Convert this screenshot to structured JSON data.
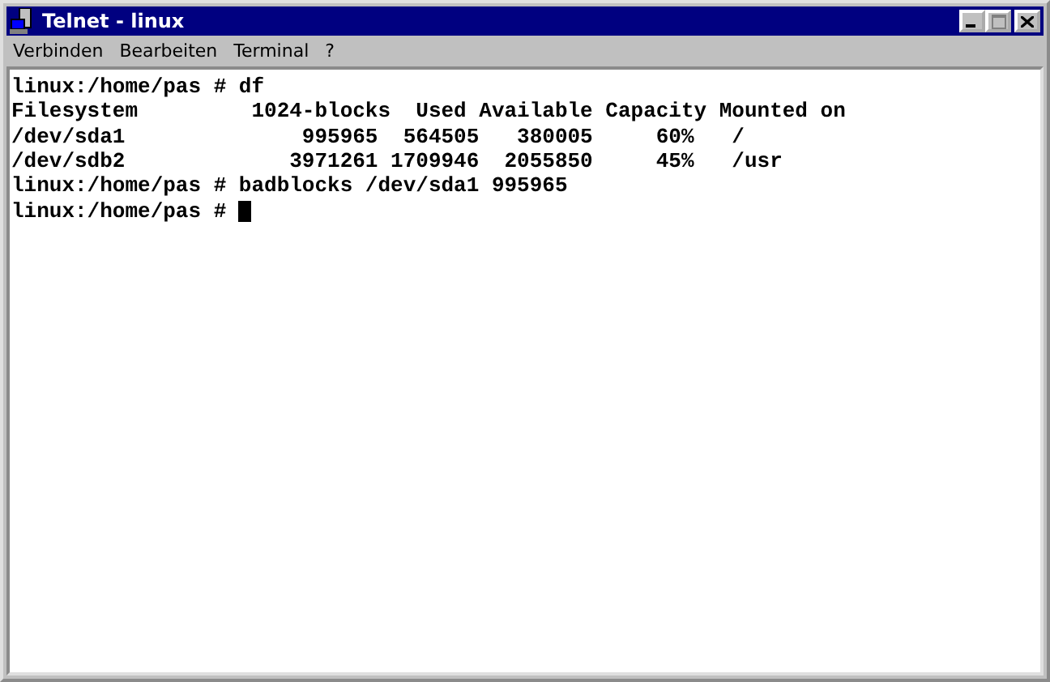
{
  "window": {
    "title": "Telnet - linux"
  },
  "menu": [
    "Verbinden",
    "Bearbeiten",
    "Terminal",
    "?"
  ],
  "terminal": {
    "lines": [
      {
        "text": "linux:/home/pas # df",
        "cursor": false
      },
      {
        "text": "Filesystem         1024-blocks  Used Available Capacity Mounted on",
        "cursor": false
      },
      {
        "text": "/dev/sda1              995965  564505   380005     60%   /",
        "cursor": false
      },
      {
        "text": "/dev/sdb2             3971261 1709946  2055850     45%   /usr",
        "cursor": false
      },
      {
        "text": "linux:/home/pas # badblocks /dev/sda1 995965",
        "cursor": false
      },
      {
        "text": "linux:/home/pas # ",
        "cursor": true
      }
    ]
  }
}
